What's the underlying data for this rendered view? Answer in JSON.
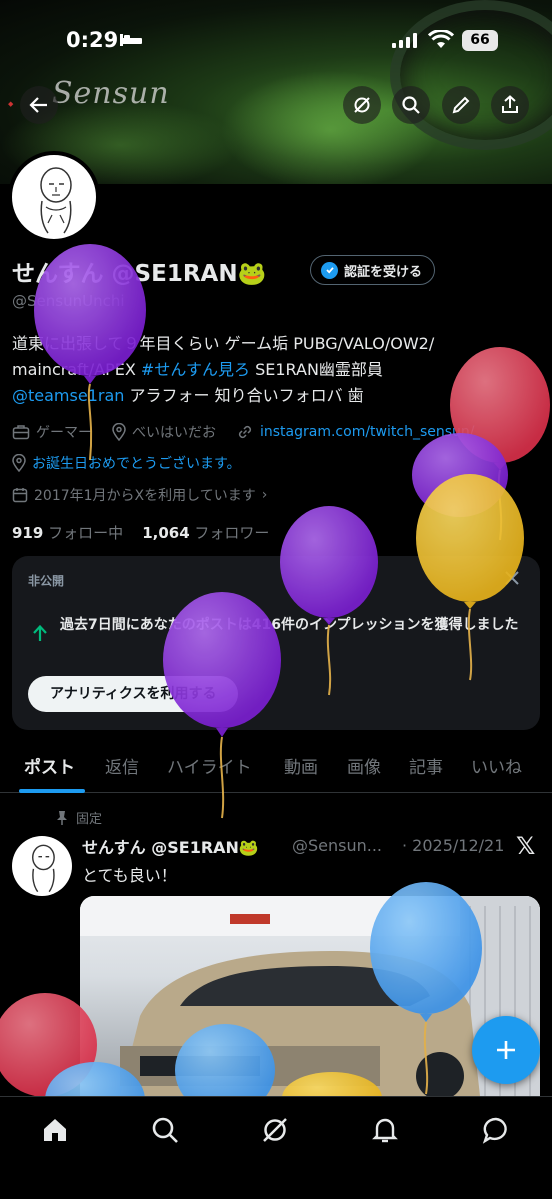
{
  "status_bar": {
    "time": "0:29",
    "battery": "66"
  },
  "banner": {
    "title_text": "Sensun"
  },
  "profile": {
    "display_name": "せんすん @SE1RAN🐸",
    "handle": "@SensunUnchi",
    "verify_button": "認証を受ける",
    "bio_line1": "道東に出張して９年目くらい ゲーム垢 PUBG/VALO/OW2/",
    "bio_line2_a": "maincraft/APEX ",
    "bio_hashtag": "#せんすん見ろ",
    "bio_line2_b": " SE1RAN幽霊部員",
    "bio_mention": "@teamse1ran",
    "bio_line3_b": " アラフォー 知り合いフォロバ 歯",
    "category": "ゲーマー",
    "location": "べいはいだお",
    "website": "instagram.com/twitch_sensun/",
    "birthday": "お誕生日おめでとうございます。",
    "joined": "2017年1月からXを利用しています",
    "following_count": "919",
    "following_label": "フォロー中",
    "followers_count": "1,064",
    "followers_label": "フォロワー"
  },
  "analytics_card": {
    "label": "非公開",
    "message": "過去7日間にあなたのポストは416件のインプレッションを獲得しました",
    "button": "アナリティクスを利用する"
  },
  "tabs": [
    {
      "label": "ポスト",
      "active": true
    },
    {
      "label": "返信"
    },
    {
      "label": "ハイライト"
    },
    {
      "label": "動画"
    },
    {
      "label": "画像"
    },
    {
      "label": "記事"
    },
    {
      "label": "いいね"
    }
  ],
  "post": {
    "pinned_label": "固定",
    "author": "せんすん @SE1RAN🐸",
    "handle": "@Sensun...",
    "date": "· 2025/12/21",
    "text": "とても良い！"
  },
  "colors": {
    "accent": "#1d9bf0",
    "background": "#000000",
    "card": "#16181c",
    "muted": "#71767b",
    "balloon_purple": "#8a2be2",
    "balloon_red": "#e0455a",
    "balloon_yellow": "#f2c230",
    "balloon_blue": "#4aa3f0"
  },
  "icons": {
    "back": "back-arrow-icon",
    "grok": "grok-icon",
    "search": "search-icon",
    "edit": "edit-pencil-icon",
    "share": "share-icon",
    "fab": "plus-icon",
    "nav": [
      "home-icon",
      "search-icon",
      "grok-icon",
      "bell-icon",
      "messages-icon"
    ]
  }
}
